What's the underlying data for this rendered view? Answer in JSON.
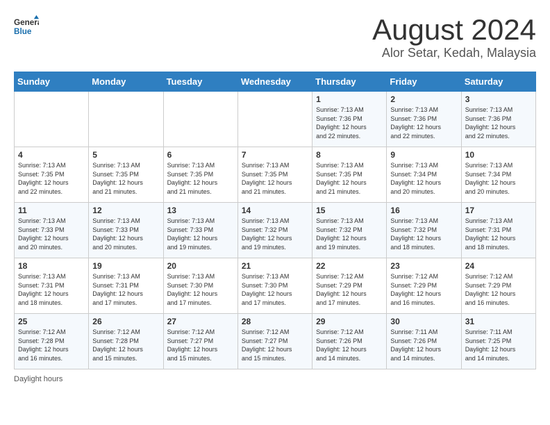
{
  "header": {
    "logo_line1": "General",
    "logo_line2": "Blue",
    "month_year": "August 2024",
    "location": "Alor Setar, Kedah, Malaysia"
  },
  "days_of_week": [
    "Sunday",
    "Monday",
    "Tuesday",
    "Wednesday",
    "Thursday",
    "Friday",
    "Saturday"
  ],
  "weeks": [
    [
      {
        "day": "",
        "info": ""
      },
      {
        "day": "",
        "info": ""
      },
      {
        "day": "",
        "info": ""
      },
      {
        "day": "",
        "info": ""
      },
      {
        "day": "1",
        "info": "Sunrise: 7:13 AM\nSunset: 7:36 PM\nDaylight: 12 hours\nand 22 minutes."
      },
      {
        "day": "2",
        "info": "Sunrise: 7:13 AM\nSunset: 7:36 PM\nDaylight: 12 hours\nand 22 minutes."
      },
      {
        "day": "3",
        "info": "Sunrise: 7:13 AM\nSunset: 7:36 PM\nDaylight: 12 hours\nand 22 minutes."
      }
    ],
    [
      {
        "day": "4",
        "info": "Sunrise: 7:13 AM\nSunset: 7:35 PM\nDaylight: 12 hours\nand 22 minutes."
      },
      {
        "day": "5",
        "info": "Sunrise: 7:13 AM\nSunset: 7:35 PM\nDaylight: 12 hours\nand 21 minutes."
      },
      {
        "day": "6",
        "info": "Sunrise: 7:13 AM\nSunset: 7:35 PM\nDaylight: 12 hours\nand 21 minutes."
      },
      {
        "day": "7",
        "info": "Sunrise: 7:13 AM\nSunset: 7:35 PM\nDaylight: 12 hours\nand 21 minutes."
      },
      {
        "day": "8",
        "info": "Sunrise: 7:13 AM\nSunset: 7:35 PM\nDaylight: 12 hours\nand 21 minutes."
      },
      {
        "day": "9",
        "info": "Sunrise: 7:13 AM\nSunset: 7:34 PM\nDaylight: 12 hours\nand 20 minutes."
      },
      {
        "day": "10",
        "info": "Sunrise: 7:13 AM\nSunset: 7:34 PM\nDaylight: 12 hours\nand 20 minutes."
      }
    ],
    [
      {
        "day": "11",
        "info": "Sunrise: 7:13 AM\nSunset: 7:33 PM\nDaylight: 12 hours\nand 20 minutes."
      },
      {
        "day": "12",
        "info": "Sunrise: 7:13 AM\nSunset: 7:33 PM\nDaylight: 12 hours\nand 20 minutes."
      },
      {
        "day": "13",
        "info": "Sunrise: 7:13 AM\nSunset: 7:33 PM\nDaylight: 12 hours\nand 19 minutes."
      },
      {
        "day": "14",
        "info": "Sunrise: 7:13 AM\nSunset: 7:32 PM\nDaylight: 12 hours\nand 19 minutes."
      },
      {
        "day": "15",
        "info": "Sunrise: 7:13 AM\nSunset: 7:32 PM\nDaylight: 12 hours\nand 19 minutes."
      },
      {
        "day": "16",
        "info": "Sunrise: 7:13 AM\nSunset: 7:32 PM\nDaylight: 12 hours\nand 18 minutes."
      },
      {
        "day": "17",
        "info": "Sunrise: 7:13 AM\nSunset: 7:31 PM\nDaylight: 12 hours\nand 18 minutes."
      }
    ],
    [
      {
        "day": "18",
        "info": "Sunrise: 7:13 AM\nSunset: 7:31 PM\nDaylight: 12 hours\nand 18 minutes."
      },
      {
        "day": "19",
        "info": "Sunrise: 7:13 AM\nSunset: 7:31 PM\nDaylight: 12 hours\nand 17 minutes."
      },
      {
        "day": "20",
        "info": "Sunrise: 7:13 AM\nSunset: 7:30 PM\nDaylight: 12 hours\nand 17 minutes."
      },
      {
        "day": "21",
        "info": "Sunrise: 7:13 AM\nSunset: 7:30 PM\nDaylight: 12 hours\nand 17 minutes."
      },
      {
        "day": "22",
        "info": "Sunrise: 7:12 AM\nSunset: 7:29 PM\nDaylight: 12 hours\nand 17 minutes."
      },
      {
        "day": "23",
        "info": "Sunrise: 7:12 AM\nSunset: 7:29 PM\nDaylight: 12 hours\nand 16 minutes."
      },
      {
        "day": "24",
        "info": "Sunrise: 7:12 AM\nSunset: 7:29 PM\nDaylight: 12 hours\nand 16 minutes."
      }
    ],
    [
      {
        "day": "25",
        "info": "Sunrise: 7:12 AM\nSunset: 7:28 PM\nDaylight: 12 hours\nand 16 minutes."
      },
      {
        "day": "26",
        "info": "Sunrise: 7:12 AM\nSunset: 7:28 PM\nDaylight: 12 hours\nand 15 minutes."
      },
      {
        "day": "27",
        "info": "Sunrise: 7:12 AM\nSunset: 7:27 PM\nDaylight: 12 hours\nand 15 minutes."
      },
      {
        "day": "28",
        "info": "Sunrise: 7:12 AM\nSunset: 7:27 PM\nDaylight: 12 hours\nand 15 minutes."
      },
      {
        "day": "29",
        "info": "Sunrise: 7:12 AM\nSunset: 7:26 PM\nDaylight: 12 hours\nand 14 minutes."
      },
      {
        "day": "30",
        "info": "Sunrise: 7:11 AM\nSunset: 7:26 PM\nDaylight: 12 hours\nand 14 minutes."
      },
      {
        "day": "31",
        "info": "Sunrise: 7:11 AM\nSunset: 7:25 PM\nDaylight: 12 hours\nand 14 minutes."
      }
    ]
  ],
  "footer": {
    "note": "Daylight hours"
  }
}
